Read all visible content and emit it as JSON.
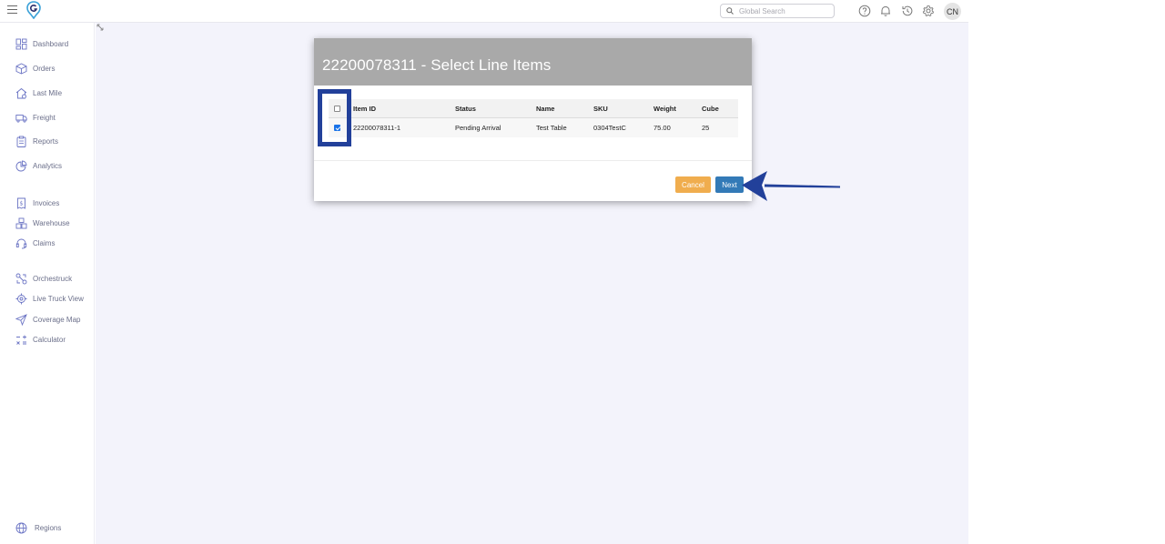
{
  "topbar": {
    "search_placeholder": "Global Search",
    "avatar_initials": "CN",
    "icons": [
      "help-icon",
      "bell-icon",
      "history-icon",
      "gear-icon"
    ]
  },
  "sidebar": {
    "items": [
      {
        "label": "Dashboard",
        "icon": "dashboard-icon"
      },
      {
        "label": "Orders",
        "icon": "box-icon"
      },
      {
        "label": "Last Mile",
        "icon": "house-icon"
      },
      {
        "label": "Freight",
        "icon": "truck-icon"
      },
      {
        "label": "Reports",
        "icon": "clipboard-icon"
      },
      {
        "label": "Analytics",
        "icon": "analytics-icon"
      },
      {
        "label": "Invoices",
        "icon": "invoice-icon"
      },
      {
        "label": "Warehouse",
        "icon": "warehouse-icon"
      },
      {
        "label": "Claims",
        "icon": "headset-icon"
      },
      {
        "label": "Orchestruck",
        "icon": "orchestruck-icon"
      },
      {
        "label": "Live Truck View",
        "icon": "target-icon"
      },
      {
        "label": "Coverage Map",
        "icon": "send-icon"
      },
      {
        "label": "Calculator",
        "icon": "calculator-icon"
      },
      {
        "label": "Regions",
        "icon": "globe-icon"
      }
    ]
  },
  "modal": {
    "title": "22200078311 - Select Line Items",
    "table": {
      "headers": {
        "item_id": "Item ID",
        "status": "Status",
        "name": "Name",
        "sku": "SKU",
        "weight": "Weight",
        "cube": "Cube"
      },
      "rows": [
        {
          "checked": true,
          "item_id": "22200078311-1",
          "status": "Pending Arrival",
          "name": "Test Table",
          "sku": "0304TestC",
          "weight": "75.00",
          "cube": "25"
        }
      ]
    },
    "buttons": {
      "cancel": "Cancel",
      "next": "Next"
    }
  },
  "colors": {
    "accent": "#337ab7",
    "cancel": "#f0ad4e",
    "annotation": "#22409a",
    "modal_header": "#a9a9a9",
    "content_bg": "#f3f3fb"
  }
}
